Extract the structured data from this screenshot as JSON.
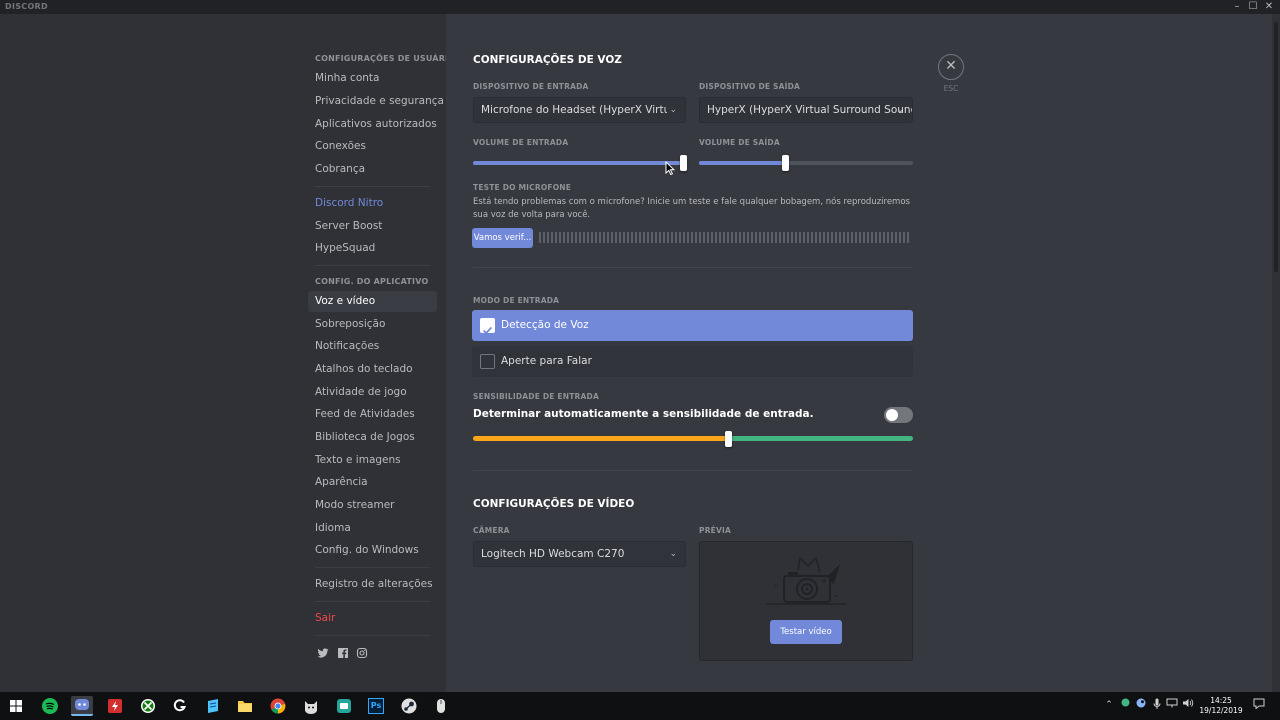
{
  "window": {
    "title": "DISCORD"
  },
  "sidebar": {
    "user_settings_header": "CONFIGURAÇÕES DE USUÁRIO",
    "user_items": [
      "Minha conta",
      "Privacidade e segurança",
      "Aplicativos autorizados",
      "Conexões",
      "Cobrança"
    ],
    "nitro_items": [
      "Discord Nitro",
      "Server Boost",
      "HypeSquad"
    ],
    "app_settings_header": "CONFIG. DO APLICATIVO",
    "app_items": [
      "Voz e vídeo",
      "Sobreposição",
      "Notificações",
      "Atalhos do teclado",
      "Atividade de jogo",
      "Feed de Atividades",
      "Biblioteca de Jogos",
      "Texto e imagens",
      "Aparência",
      "Modo streamer",
      "Idioma",
      "Config. do Windows"
    ],
    "changelog": "Registro de alterações",
    "logout": "Sair",
    "social_icons": [
      "twitter-icon",
      "facebook-icon",
      "instagram-icon"
    ]
  },
  "voice": {
    "title": "CONFIGURAÇÕES DE VOZ",
    "input_device_label": "DISPOSITIVO DE ENTRADA",
    "input_device_value": "Microfone do Headset (HyperX Virtual Surround Sound)",
    "output_device_label": "DISPOSITIVO DE SAÍDA",
    "output_device_value": "HyperX (HyperX Virtual Surround Sound)",
    "input_volume_label": "VOLUME DE ENTRADA",
    "input_volume": 100,
    "output_volume_label": "VOLUME DE SAÍDA",
    "output_volume": 40,
    "mic_test_label": "TESTE DO MICROFONE",
    "mic_test_desc": "Está tendo problemas com o microfone? Inicie um teste e fale qualquer bobagem, nós reproduziremos sua voz de volta para você.",
    "mic_test_button": "Vamos verif...",
    "input_mode_label": "MODO DE ENTRADA",
    "input_modes": [
      {
        "label": "Detecção de Voz",
        "selected": true
      },
      {
        "label": "Aperte para Falar",
        "selected": false
      }
    ],
    "sensitivity_label": "SENSIBILIDADE DE ENTRADA",
    "auto_sensitivity_text": "Determinar automaticamente a sensibilidade de entrada.",
    "auto_sensitivity_enabled": false,
    "sensitivity_fraction": 0.58
  },
  "video": {
    "title": "CONFIGURAÇÕES DE VÍDEO",
    "camera_label": "CÂMERA",
    "camera_value": "Logitech HD Webcam C270",
    "preview_label": "PRÉVIA",
    "test_button": "Testar vídeo"
  },
  "close": {
    "esc_label": "ESC"
  },
  "colors": {
    "accent": "#7289da",
    "danger": "#f04747",
    "sensitivity_low": "#faa61a",
    "sensitivity_high": "#43b581"
  },
  "taskbar": {
    "apps": [
      "windows-start-icon",
      "spotify-icon",
      "discord-icon",
      "app-red-icon",
      "xbox-icon",
      "app-g-icon",
      "app-notes-icon",
      "file-explorer-icon",
      "chrome-icon",
      "app-cat-icon",
      "app-green-icon",
      "photoshop-icon",
      "steam-icon",
      "app-mouse-icon"
    ],
    "photoshop_text": "Ps",
    "time": "14:25",
    "date": "19/12/2019"
  }
}
